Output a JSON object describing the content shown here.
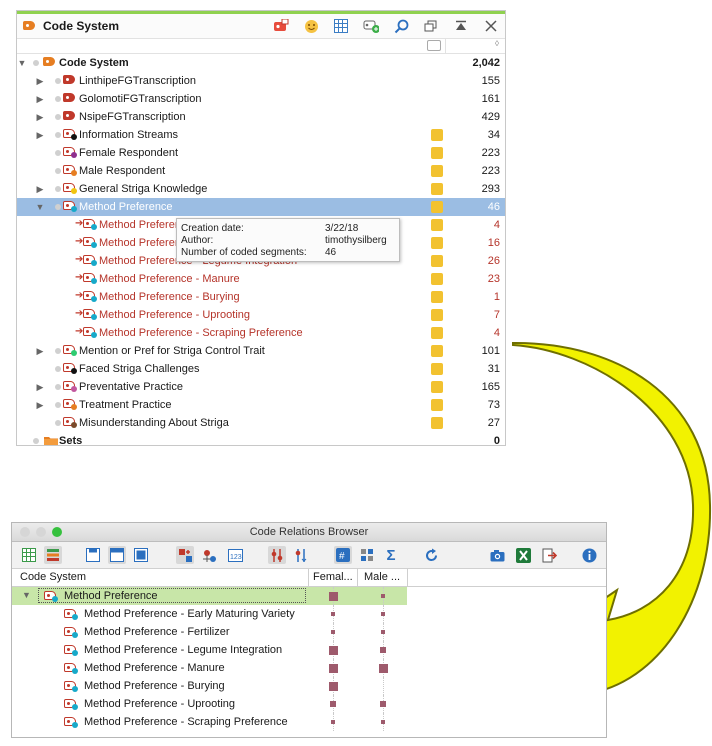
{
  "code_system": {
    "title": "Code System",
    "root": {
      "label": "Code System",
      "count": "2,042"
    },
    "items": [
      {
        "label": "LinthipeFGTranscription",
        "count": "155",
        "type": "doc",
        "expander": true,
        "memo": false
      },
      {
        "label": "GolomotiFGTranscription",
        "count": "161",
        "type": "doc",
        "expander": true,
        "memo": false
      },
      {
        "label": "NsipeFGTranscription",
        "count": "429",
        "type": "doc",
        "expander": true,
        "memo": false
      },
      {
        "label": "Information Streams",
        "count": "34",
        "type": "code",
        "color": "#111111",
        "expander": true,
        "memo": true
      },
      {
        "label": "Female Respondent",
        "count": "223",
        "type": "code",
        "color": "#8e2f8e",
        "expander": false,
        "memo": true
      },
      {
        "label": "Male Respondent",
        "count": "223",
        "type": "code",
        "color": "#e67e22",
        "expander": false,
        "memo": true
      },
      {
        "label": "General Striga Knowledge",
        "count": "293",
        "type": "code",
        "color": "#f1c40f",
        "expander": true,
        "memo": true
      },
      {
        "label": "Method Preference",
        "count": "46",
        "type": "code",
        "color": "#17a9c9",
        "expander": true,
        "expanded": true,
        "selected": true,
        "memo": true
      },
      {
        "label": "Method Preference - Early Maturing Variety",
        "count": "4",
        "type": "sub",
        "color": "#17a9c9",
        "memo": true
      },
      {
        "label": "Method Preference - Fertilizer",
        "count": "16",
        "type": "sub",
        "color": "#17a9c9",
        "memo": true
      },
      {
        "label": "Method Preference - Legume Integration",
        "count": "26",
        "type": "sub",
        "color": "#17a9c9",
        "memo": true
      },
      {
        "label": "Method Preference - Manure",
        "count": "23",
        "type": "sub",
        "color": "#17a9c9",
        "memo": true
      },
      {
        "label": "Method Preference - Burying",
        "count": "1",
        "type": "sub",
        "color": "#17a9c9",
        "memo": true
      },
      {
        "label": "Method Preference - Uprooting",
        "count": "7",
        "type": "sub",
        "color": "#17a9c9",
        "memo": true
      },
      {
        "label": "Method Preference - Scraping Preference",
        "count": "4",
        "type": "sub",
        "color": "#17a9c9",
        "memo": true
      },
      {
        "label": "Mention or Pref for Striga Control Trait",
        "count": "101",
        "type": "code",
        "color": "#2ecc71",
        "expander": true,
        "memo": true
      },
      {
        "label": "Faced Striga Challenges",
        "count": "31",
        "type": "code",
        "color": "#111111",
        "expander": false,
        "memo": true
      },
      {
        "label": "Preventative Practice",
        "count": "165",
        "type": "code",
        "color": "#c2579e",
        "expander": true,
        "memo": true
      },
      {
        "label": "Treatment Practice",
        "count": "73",
        "type": "code",
        "color": "#e67e22",
        "expander": true,
        "memo": true
      },
      {
        "label": "Misunderstanding About Striga",
        "count": "27",
        "type": "code",
        "color": "#7a4a2a",
        "expander": false,
        "memo": true
      }
    ],
    "sets": {
      "label": "Sets",
      "count": "0"
    }
  },
  "tooltip": {
    "creation_label": "Creation date:",
    "creation_value": "3/22/18",
    "author_label": "Author:",
    "author_value": "timothysilberg",
    "segments_label": "Number of coded segments:",
    "segments_value": "46"
  },
  "code_relations_browser": {
    "title": "Code Relations Browser",
    "columns": [
      "Code System",
      "Femal...",
      "Male ..."
    ],
    "parent": {
      "label": "Method Preference",
      "female": 3,
      "male": 1
    },
    "rows": [
      {
        "label": "Method Preference - Early Maturing Variety",
        "female": 1,
        "male": 1
      },
      {
        "label": "Method Preference - Fertilizer",
        "female": 1,
        "male": 1
      },
      {
        "label": "Method Preference - Legume Integration",
        "female": 3,
        "male": 2
      },
      {
        "label": "Method Preference - Manure",
        "female": 3,
        "male": 3
      },
      {
        "label": "Method Preference - Burying",
        "female": 3,
        "male": 0
      },
      {
        "label": "Method Preference - Uprooting",
        "female": 2,
        "male": 2
      },
      {
        "label": "Method Preference - Scraping Preference",
        "female": 1,
        "male": 1
      }
    ]
  },
  "colors": {
    "memo": "#f2c230",
    "selection": "#9bbde3",
    "crb_selection": "#c8e6a8",
    "subcode_text": "#b5342a",
    "matrix_square": "#9e5a6c",
    "arrow_fill": "#f2f200",
    "arrow_stroke": "#7a7a00"
  },
  "icons": [
    "code-system-icon",
    "smiley-icon",
    "table-icon",
    "new-code-icon",
    "search-icon",
    "undock-icon",
    "maximize-icon",
    "close-icon"
  ]
}
